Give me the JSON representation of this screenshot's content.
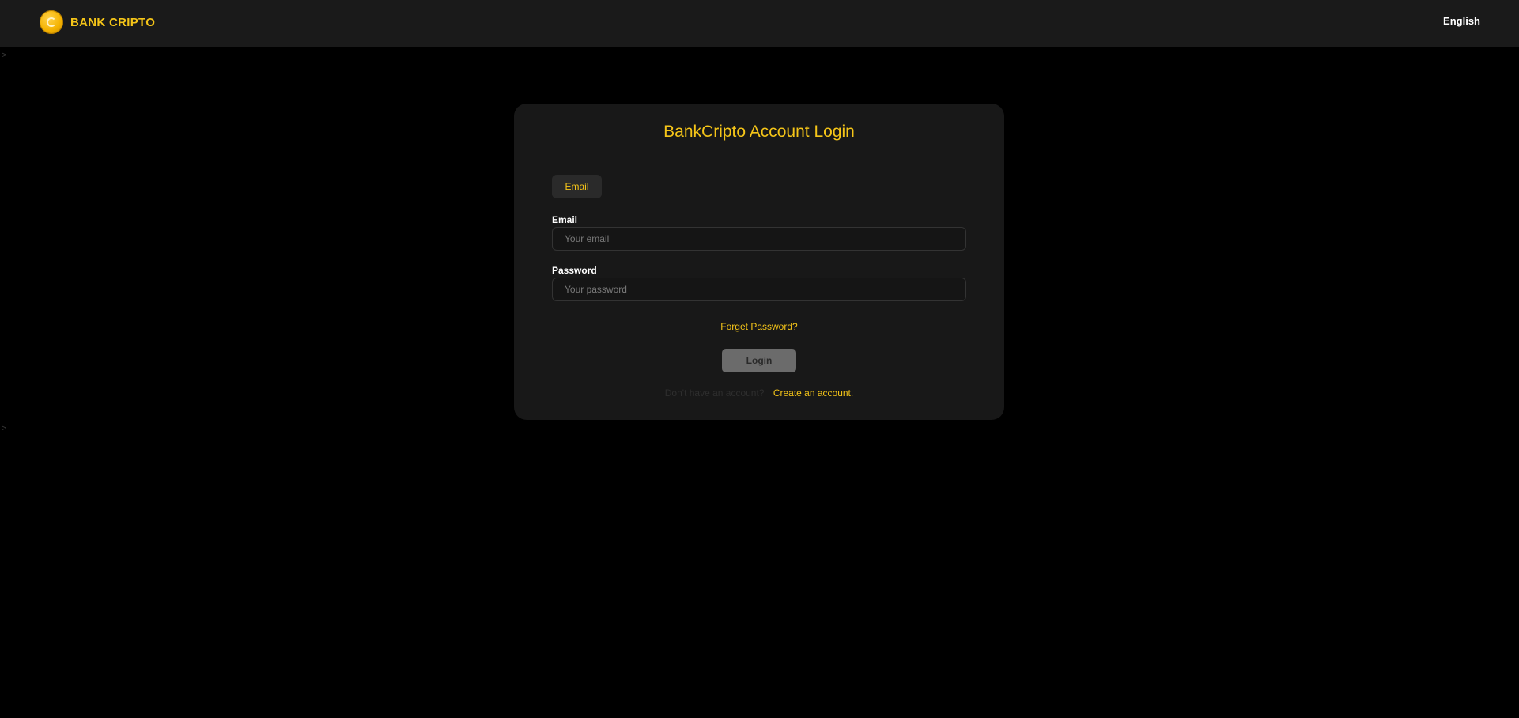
{
  "header": {
    "brand_name": "BANK CRIPTO",
    "brand_logo_icon": "coin-logo-icon",
    "language": "English"
  },
  "login": {
    "title": "BankCripto Account Login",
    "tab_label": "Email",
    "email_label": "Email",
    "email_placeholder": "Your email",
    "email_value": "",
    "password_label": "Password",
    "password_placeholder": "Your password",
    "password_value": "",
    "forgot_label": "Forget Password?",
    "login_label": "Login",
    "signup_prompt": "Don't have an account?",
    "signup_link": "Create an account."
  },
  "colors": {
    "accent": "#f5c518",
    "background": "#000000",
    "surface": "#181818"
  }
}
